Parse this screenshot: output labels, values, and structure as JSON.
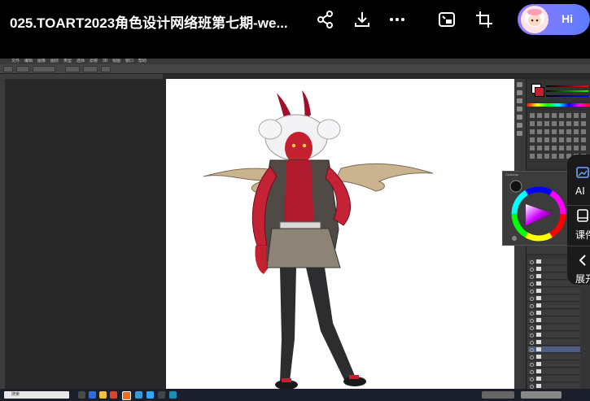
{
  "video_title": "025.TOART2023角色设计网络班第七期-we...",
  "toolbar": {
    "share_icon": "share-icon",
    "download_icon": "download-icon",
    "more_icon": "more-icon",
    "pip_icon": "picture-in-picture-icon",
    "crop_icon": "crop-icon"
  },
  "assistant": {
    "label": "Hi"
  },
  "side_panel": {
    "ai_label": "AI",
    "courseware_label": "课件",
    "expand_label": "展开"
  },
  "photoshop": {
    "menu_items": [
      "文件",
      "编辑",
      "图像",
      "图层",
      "类型",
      "选择",
      "滤镜",
      "3D",
      "视图",
      "窗口",
      "帮助"
    ],
    "color_panel_title": "Coolorus"
  },
  "taskbar": {
    "search_text": "搜索"
  },
  "colors": {
    "background": "#000000",
    "ps_workspace": "#282828",
    "canvas": "#ffffff",
    "assistant_gradient_start": "#8f7bff",
    "assistant_gradient_end": "#5c7bff"
  }
}
